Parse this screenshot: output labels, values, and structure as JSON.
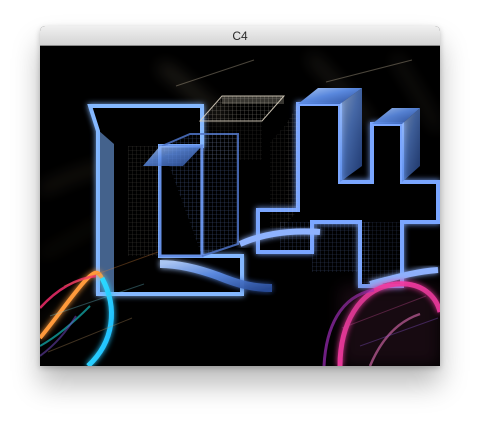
{
  "window": {
    "title": "C4"
  },
  "canvas": {
    "content": "c4-glow-logo-render",
    "accent_colors": [
      "#5d8fe8",
      "#9cc3ff",
      "#ff8a3a",
      "#2de0ff",
      "#ff3aa8",
      "#d7c7a6"
    ]
  }
}
